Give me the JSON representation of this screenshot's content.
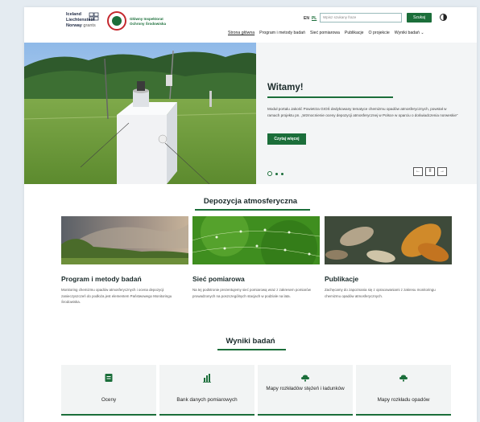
{
  "header": {
    "logo_norway": {
      "line1": "Iceland",
      "line2": "Liechtenstein",
      "line3": "Norway",
      "grants": "grants"
    },
    "logo_gios": {
      "line1": "Główny Inspektorat",
      "line2": "Ochrony Środowiska"
    },
    "lang_en": "EN",
    "lang_pl": "PL",
    "search_placeholder": "Wpisz szukany fraze",
    "search_button": "Szukaj"
  },
  "nav": {
    "items": [
      {
        "label": "Strona główna"
      },
      {
        "label": "Program i metody badań"
      },
      {
        "label": "Sieć pomiarowa"
      },
      {
        "label": "Publikacje"
      },
      {
        "label": "O projekcie"
      },
      {
        "label": "Wyniki badań"
      }
    ]
  },
  "hero": {
    "title": "Witamy!",
    "description": "Moduł portalu Jakość Powietrza GIOŚ dedykowany tematyce chemizmu opadów atmosferycznych, powstał w ramach projektu pn. „Wzmocnienie oceny depozycji atmosferycznej w Polsce w oparciu o doświadczenia norweskie”",
    "cta": "Czytaj więcej",
    "prev": "←",
    "pause": "II",
    "next": "→"
  },
  "deposition": {
    "title": "Depozycja atmosferyczna",
    "cards": [
      {
        "title": "Program i metody badań",
        "desc": "Monitoring chemizmu opadów atmosferycznych i ocena depozycji zanieczyszczeń do podłoża jest elementem Państwowego Monitoringu Środowiska."
      },
      {
        "title": "Sieć pomiarowa",
        "desc": "Na tej podstronie prezentujemy sieć pomiarową wraz z zakresem pomiarów prowadzonych na poszczególnych stacjach w podziale na lata."
      },
      {
        "title": "Publikacje",
        "desc": "Zachęcamy do zapoznania się z opracowaniami z zakresu monitoringu chemizmu opadów atmosferycznych."
      }
    ]
  },
  "results": {
    "title": "Wyniki badań",
    "tiles": [
      {
        "label": "Oceny",
        "icon": "document-icon"
      },
      {
        "label": "Bank danych pomiarowych",
        "icon": "bar-chart-icon"
      },
      {
        "label": "Mapy rozkładów stężeń i ładunków",
        "icon": "map-cloud-icon"
      },
      {
        "label": "Mapy rozkładu opadów",
        "icon": "rain-cloud-icon"
      }
    ]
  },
  "colors": {
    "brand_green": "#1b6e3a",
    "accent_red": "#c4282e"
  }
}
